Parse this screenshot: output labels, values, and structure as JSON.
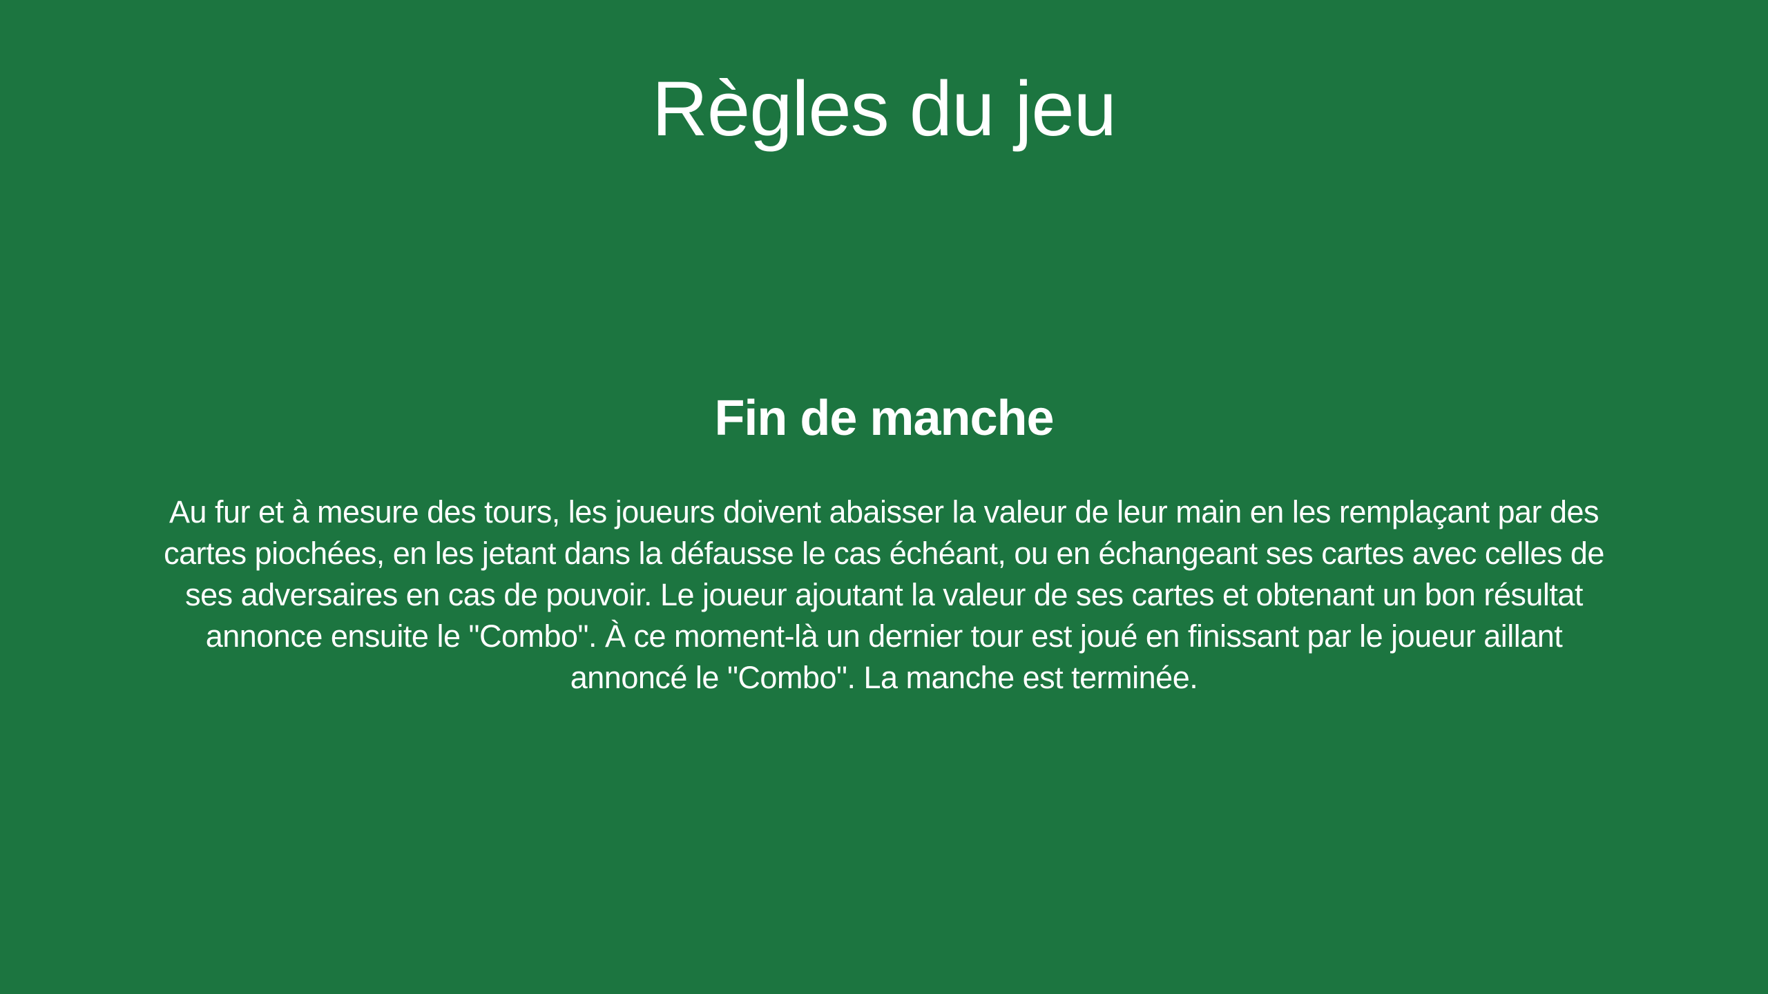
{
  "page": {
    "title": "Règles du jeu",
    "background_color": "#1c7540",
    "text_color": "#ffffff"
  },
  "section": {
    "heading": "Fin de manche",
    "body": "Au fur et à mesure des tours, les joueurs doivent abaisser la valeur de leur main en les remplaçant par des cartes piochées, en les jetant dans la défausse le cas échéant, ou en échangeant ses cartes avec celles de ses adversaires en cas de pouvoir. Le joueur ajoutant la valeur de ses cartes et obtenant un bon résultat annonce ensuite le \"Combo\". À ce moment-là un dernier tour est joué en finissant par le joueur aillant annoncé le \"Combo\". La manche est terminée."
  }
}
